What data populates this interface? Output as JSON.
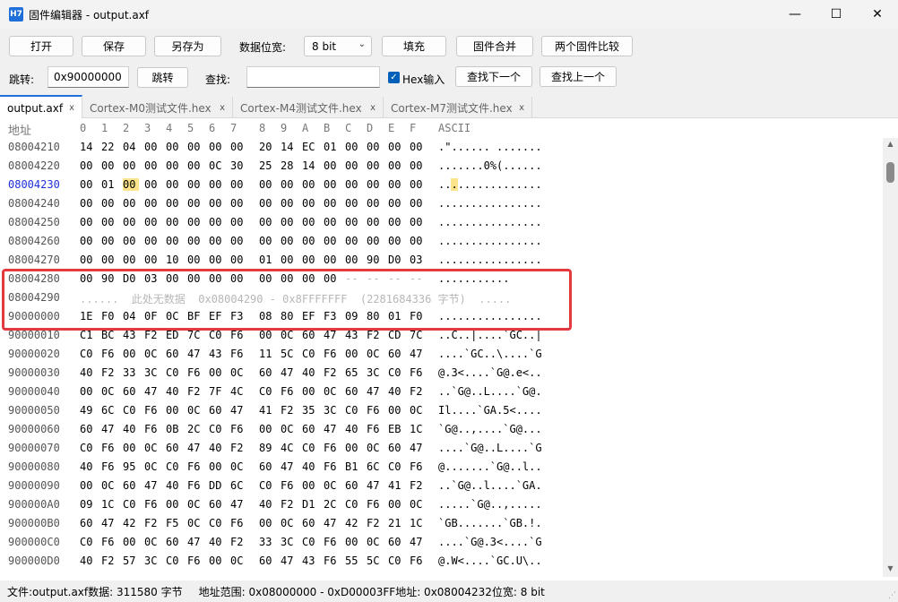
{
  "window": {
    "icon_text": "H7",
    "title": "固件编辑器 - output.axf",
    "minimize": "—",
    "maximize": "☐",
    "close": "✕"
  },
  "toolbar": {
    "open": "打开",
    "save": "保存",
    "save_as": "另存为",
    "data_width_label": "数据位宽:",
    "data_width_value": "8 bit",
    "fill": "填充",
    "merge": "固件合并",
    "compare": "两个固件比较",
    "jump_label": "跳转:",
    "jump_value": "0x90000000",
    "jump_button": "跳转",
    "find_label": "查找:",
    "find_value": "",
    "hex_input_label": "Hex输入",
    "find_next": "查找下一个",
    "find_prev": "查找上一个"
  },
  "tabs": [
    {
      "label": "output.axf",
      "close": "x"
    },
    {
      "label": "Cortex-M0测试文件.hex",
      "close": "x"
    },
    {
      "label": "Cortex-M4测试文件.hex",
      "close": "x"
    },
    {
      "label": "Cortex-M7测试文件.hex",
      "close": "x"
    }
  ],
  "hex": {
    "addr_header": "地址",
    "col_headers": [
      "0",
      "1",
      "2",
      "3",
      "4",
      "5",
      "6",
      "7",
      "8",
      "9",
      "A",
      "B",
      "C",
      "D",
      "E",
      "F"
    ],
    "ascii_header": "ASCII",
    "rows": [
      {
        "addr": "08004210",
        "bytes": [
          "14",
          "22",
          "04",
          "00",
          "00",
          "00",
          "00",
          "00",
          "20",
          "14",
          "EC",
          "01",
          "00",
          "00",
          "00",
          "00"
        ],
        "ascii": ".\"...... ......."
      },
      {
        "addr": "08004220",
        "bytes": [
          "00",
          "00",
          "00",
          "00",
          "00",
          "00",
          "0C",
          "30",
          "25",
          "28",
          "14",
          "00",
          "00",
          "00",
          "00",
          "00"
        ],
        "ascii": ".......0%(......"
      },
      {
        "addr": "08004230",
        "bytes": [
          "00",
          "01",
          "00",
          "00",
          "00",
          "00",
          "00",
          "00",
          "00",
          "00",
          "00",
          "00",
          "00",
          "00",
          "00",
          "00"
        ],
        "ascii": "................"
      },
      {
        "addr": "08004240",
        "bytes": [
          "00",
          "00",
          "00",
          "00",
          "00",
          "00",
          "00",
          "00",
          "00",
          "00",
          "00",
          "00",
          "00",
          "00",
          "00",
          "00"
        ],
        "ascii": "................"
      },
      {
        "addr": "08004250",
        "bytes": [
          "00",
          "00",
          "00",
          "00",
          "00",
          "00",
          "00",
          "00",
          "00",
          "00",
          "00",
          "00",
          "00",
          "00",
          "00",
          "00"
        ],
        "ascii": "................"
      },
      {
        "addr": "08004260",
        "bytes": [
          "00",
          "00",
          "00",
          "00",
          "00",
          "00",
          "00",
          "00",
          "00",
          "00",
          "00",
          "00",
          "00",
          "00",
          "00",
          "00"
        ],
        "ascii": "................"
      },
      {
        "addr": "08004270",
        "bytes": [
          "00",
          "00",
          "00",
          "00",
          "10",
          "00",
          "00",
          "00",
          "01",
          "00",
          "00",
          "00",
          "00",
          "90",
          "D0",
          "03"
        ],
        "ascii": "................"
      },
      {
        "addr": "08004280",
        "bytes": [
          "00",
          "90",
          "D0",
          "03",
          "00",
          "00",
          "00",
          "00",
          "00",
          "00",
          "00",
          "00",
          "--",
          "--",
          "--",
          "--"
        ],
        "ascii": "..........."
      },
      {
        "addr": "08004290",
        "nodata": "......  此处无数据  0x08004290 - 0x8FFFFFFF  (2281684336 字节)  ....."
      },
      {
        "addr": "90000000",
        "bytes": [
          "1E",
          "F0",
          "04",
          "0F",
          "0C",
          "BF",
          "EF",
          "F3",
          "08",
          "80",
          "EF",
          "F3",
          "09",
          "80",
          "01",
          "F0"
        ],
        "ascii": "................"
      },
      {
        "addr": "90000010",
        "bytes": [
          "C1",
          "BC",
          "43",
          "F2",
          "ED",
          "7C",
          "C0",
          "F6",
          "00",
          "0C",
          "60",
          "47",
          "43",
          "F2",
          "CD",
          "7C"
        ],
        "ascii": "..C..|....`GC..|"
      },
      {
        "addr": "90000020",
        "bytes": [
          "C0",
          "F6",
          "00",
          "0C",
          "60",
          "47",
          "43",
          "F6",
          "11",
          "5C",
          "C0",
          "F6",
          "00",
          "0C",
          "60",
          "47"
        ],
        "ascii": "....`GC..\\....`G"
      },
      {
        "addr": "90000030",
        "bytes": [
          "40",
          "F2",
          "33",
          "3C",
          "C0",
          "F6",
          "00",
          "0C",
          "60",
          "47",
          "40",
          "F2",
          "65",
          "3C",
          "C0",
          "F6"
        ],
        "ascii": "@.3<....`G@.e<.."
      },
      {
        "addr": "90000040",
        "bytes": [
          "00",
          "0C",
          "60",
          "47",
          "40",
          "F2",
          "7F",
          "4C",
          "C0",
          "F6",
          "00",
          "0C",
          "60",
          "47",
          "40",
          "F2"
        ],
        "ascii": "..`G@..L....`G@."
      },
      {
        "addr": "90000050",
        "bytes": [
          "49",
          "6C",
          "C0",
          "F6",
          "00",
          "0C",
          "60",
          "47",
          "41",
          "F2",
          "35",
          "3C",
          "C0",
          "F6",
          "00",
          "0C"
        ],
        "ascii": "Il....`GA.5<...."
      },
      {
        "addr": "90000060",
        "bytes": [
          "60",
          "47",
          "40",
          "F6",
          "0B",
          "2C",
          "C0",
          "F6",
          "00",
          "0C",
          "60",
          "47",
          "40",
          "F6",
          "EB",
          "1C"
        ],
        "ascii": "`G@..,....`G@..."
      },
      {
        "addr": "90000070",
        "bytes": [
          "C0",
          "F6",
          "00",
          "0C",
          "60",
          "47",
          "40",
          "F2",
          "89",
          "4C",
          "C0",
          "F6",
          "00",
          "0C",
          "60",
          "47"
        ],
        "ascii": "....`G@..L....`G"
      },
      {
        "addr": "90000080",
        "bytes": [
          "40",
          "F6",
          "95",
          "0C",
          "C0",
          "F6",
          "00",
          "0C",
          "60",
          "47",
          "40",
          "F6",
          "B1",
          "6C",
          "C0",
          "F6"
        ],
        "ascii": "@.......`G@..l.."
      },
      {
        "addr": "90000090",
        "bytes": [
          "00",
          "0C",
          "60",
          "47",
          "40",
          "F6",
          "DD",
          "6C",
          "C0",
          "F6",
          "00",
          "0C",
          "60",
          "47",
          "41",
          "F2"
        ],
        "ascii": "..`G@..l....`GA."
      },
      {
        "addr": "900000A0",
        "bytes": [
          "09",
          "1C",
          "C0",
          "F6",
          "00",
          "0C",
          "60",
          "47",
          "40",
          "F2",
          "D1",
          "2C",
          "C0",
          "F6",
          "00",
          "0C"
        ],
        "ascii": ".....`G@..,....."
      },
      {
        "addr": "900000B0",
        "bytes": [
          "60",
          "47",
          "42",
          "F2",
          "F5",
          "0C",
          "C0",
          "F6",
          "00",
          "0C",
          "60",
          "47",
          "42",
          "F2",
          "21",
          "1C"
        ],
        "ascii": "`GB.......`GB.!."
      },
      {
        "addr": "900000C0",
        "bytes": [
          "C0",
          "F6",
          "00",
          "0C",
          "60",
          "47",
          "40",
          "F2",
          "33",
          "3C",
          "C0",
          "F6",
          "00",
          "0C",
          "60",
          "47"
        ],
        "ascii": "....`G@.3<....`G"
      },
      {
        "addr": "900000D0",
        "bytes": [
          "40",
          "F2",
          "57",
          "3C",
          "C0",
          "F6",
          "00",
          "0C",
          "60",
          "47",
          "43",
          "F6",
          "55",
          "5C",
          "C0",
          "F6"
        ],
        "ascii": "@.W<....`GC.U\\.."
      }
    ]
  },
  "status": {
    "file": "文件:output.axf",
    "data": "数据: 311580 字节",
    "range": "地址范围: 0x08000000 - 0xD00003FF",
    "addr": "地址: 0x08004232",
    "width": "位宽: 8 bit"
  },
  "colors": {
    "accent": "#1e6fd9",
    "highlight": "#fde48a",
    "annotation_box": "#e53940",
    "current_address": "#1f2fd8"
  }
}
